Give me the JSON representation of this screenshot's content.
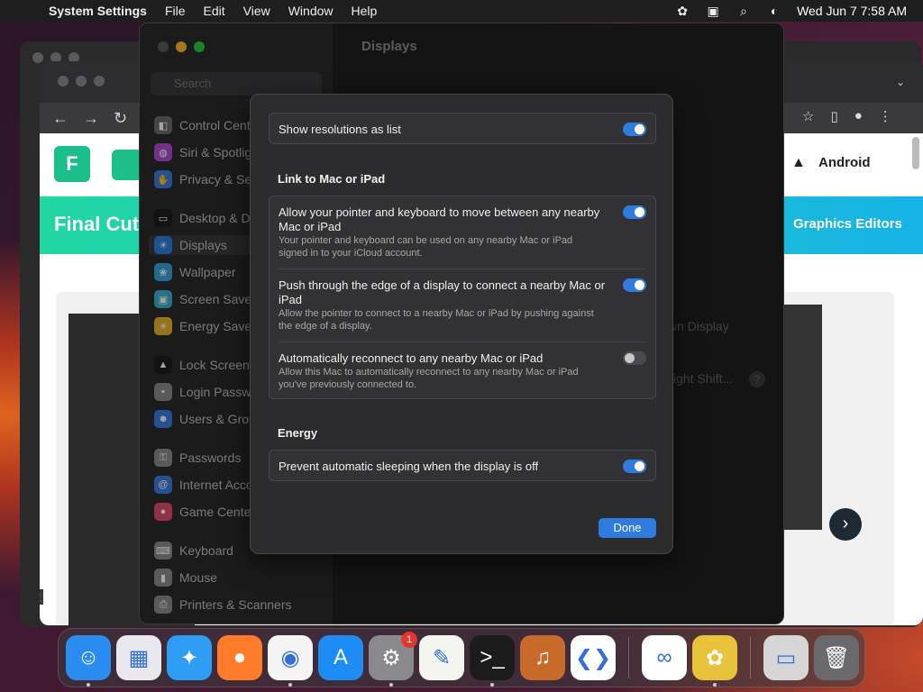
{
  "menubar": {
    "app_name": "System Settings",
    "menus": [
      "File",
      "Edit",
      "View",
      "Window",
      "Help"
    ],
    "datetime": "Wed Jun 7  7:58 AM"
  },
  "browser": {
    "site_hero_title": "Final Cut",
    "nav_android": "Android",
    "nav_graphics": "Graphics Editors",
    "status_url": "htt"
  },
  "settings": {
    "panel_title": "Displays",
    "search_placeholder": "Search",
    "sidebar": [
      {
        "label": "Control Cente",
        "icon": "control-center-icon",
        "color": "#6b6b6b"
      },
      {
        "label": "Siri & Spotlig",
        "icon": "siri-icon",
        "color": "#b04ad8"
      },
      {
        "label": "Privacy & Sec",
        "icon": "hand-icon",
        "color": "#3a7be0"
      },
      {
        "label": "Desktop & De",
        "icon": "desktop-icon",
        "color": "#1c1c1e"
      },
      {
        "label": "Displays",
        "icon": "displays-icon",
        "color": "#2d7fe0"
      },
      {
        "label": "Wallpaper",
        "icon": "wallpaper-icon",
        "color": "#36a3d9"
      },
      {
        "label": "Screen Saver",
        "icon": "screen-saver-icon",
        "color": "#38b0c8"
      },
      {
        "label": "Energy Saver",
        "icon": "energy-icon",
        "color": "#e8b22c"
      },
      {
        "label": "Lock Screen",
        "icon": "lock-icon",
        "color": "#1c1c1e"
      },
      {
        "label": "Login Passwo",
        "icon": "login-password-icon",
        "color": "#8a8a8a"
      },
      {
        "label": "Users & Grou",
        "icon": "users-icon",
        "color": "#3a7be0"
      },
      {
        "label": "Passwords",
        "icon": "key-icon",
        "color": "#8a8a8a"
      },
      {
        "label": "Internet Acco",
        "icon": "at-icon",
        "color": "#3a7be0"
      },
      {
        "label": "Game Center",
        "icon": "game-center-icon",
        "color": "#e04a6a"
      },
      {
        "label": "Keyboard",
        "icon": "keyboard-icon",
        "color": "#8a8a8a"
      },
      {
        "label": "Mouse",
        "icon": "mouse-icon",
        "color": "#8a8a8a"
      },
      {
        "label": "Printers & Scanners",
        "icon": "printer-icon",
        "color": "#8a8a8a"
      }
    ],
    "ghost_texts": {
      "display_dropdown": "wn Display",
      "night_shift": "ight Shift...",
      "help": "?"
    }
  },
  "sheet": {
    "show_resolutions_label": "Show resolutions as list",
    "show_resolutions_on": true,
    "link_section_title": "Link to Mac or iPad",
    "link_items": [
      {
        "title": "Allow your pointer and keyboard to move between any nearby Mac or iPad",
        "subtitle": "Your pointer and keyboard can be used on any nearby Mac or iPad signed in to your iCloud account.",
        "on": true
      },
      {
        "title": "Push through the edge of a display to connect a nearby Mac or iPad",
        "subtitle": "Allow the pointer to connect to a nearby Mac or iPad by pushing against the edge of a display.",
        "on": true
      },
      {
        "title": "Automatically reconnect to any nearby Mac or iPad",
        "subtitle": "Allow this Mac to automatically reconnect to any nearby Mac or iPad you've previously connected to.",
        "on": false
      }
    ],
    "energy_section_title": "Energy",
    "energy_label": "Prevent automatic sleeping when the display is off",
    "energy_on": true,
    "done_label": "Done"
  },
  "dock": {
    "apps": [
      {
        "name": "finder-icon",
        "glyph": "☺",
        "bg": "#2a8cf0"
      },
      {
        "name": "launchpad-icon",
        "glyph": "▦",
        "bg": "#e8e8ee"
      },
      {
        "name": "safari-icon",
        "glyph": "✦",
        "bg": "#2f9df5"
      },
      {
        "name": "firefox-icon",
        "glyph": "●",
        "bg": "#ff7b2a"
      },
      {
        "name": "chrome-icon",
        "glyph": "◉",
        "bg": "#f4f4f4"
      },
      {
        "name": "app-store-icon",
        "glyph": "A",
        "bg": "#1e8cf5"
      },
      {
        "name": "system-settings-icon",
        "glyph": "⚙",
        "bg": "#8a8a8e"
      },
      {
        "name": "textedit-icon",
        "glyph": "✎",
        "bg": "#f5f5f0"
      },
      {
        "name": "terminal-icon",
        "glyph": ">_",
        "bg": "#1c1c1c"
      },
      {
        "name": "garageband-icon",
        "glyph": "♫",
        "bg": "#c86a2a"
      },
      {
        "name": "vscode-icon",
        "glyph": "❮❯",
        "bg": "#ffffff"
      }
    ],
    "apps2": [
      {
        "name": "visual-studio-icon",
        "glyph": "∞",
        "bg": "#ffffff"
      },
      {
        "name": "cyberduck-icon",
        "glyph": "✿",
        "bg": "#e8c23a"
      }
    ],
    "apps3": [
      {
        "name": "screenshot-thumbnail-icon",
        "glyph": "▭",
        "bg": "#d6d6d6"
      },
      {
        "name": "trash-icon",
        "glyph": "🗑",
        "bg": "#6a6a6e"
      }
    ],
    "settings_badge": "1"
  }
}
